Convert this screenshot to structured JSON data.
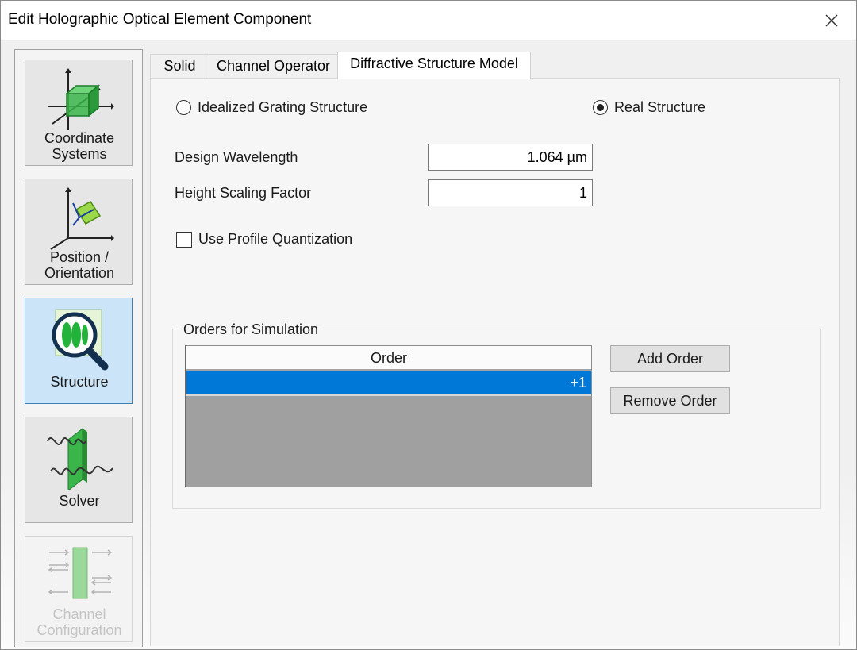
{
  "window": {
    "title": "Edit Holographic Optical Element Component"
  },
  "sidebar": {
    "items": [
      {
        "label_line1": "Coordinate",
        "label_line2": "Systems",
        "state": "normal"
      },
      {
        "label_line1": "Position /",
        "label_line2": "Orientation",
        "state": "normal"
      },
      {
        "label_line1": "Structure",
        "label_line2": "",
        "state": "selected"
      },
      {
        "label_line1": "Solver",
        "label_line2": "",
        "state": "normal"
      },
      {
        "label_line1": "Channel",
        "label_line2": "Configuration",
        "state": "disabled"
      }
    ]
  },
  "tabs": [
    {
      "label": "Solid",
      "active": false
    },
    {
      "label": "Channel Operator",
      "active": false
    },
    {
      "label": "Diffractive Structure Model",
      "active": true
    }
  ],
  "structure_model": {
    "options": [
      {
        "label": "Idealized Grating Structure",
        "selected": false
      },
      {
        "label": "Real Structure",
        "selected": true
      }
    ]
  },
  "fields": {
    "design_wavelength": {
      "label": "Design Wavelength",
      "value": "1.064 µm"
    },
    "height_scaling": {
      "label": "Height Scaling Factor",
      "value": "1"
    }
  },
  "quantization": {
    "label": "Use Profile Quantization",
    "checked": false
  },
  "orders_group": {
    "title": "Orders for Simulation",
    "column_header": "Order",
    "rows": [
      "+1"
    ],
    "add_label": "Add Order",
    "remove_label": "Remove Order"
  },
  "colors": {
    "selection": "#0078d7",
    "nav_selected_bg": "#cce4f7",
    "nav_selected_border": "#3c7fb1",
    "icon_green": "#39b54a"
  }
}
